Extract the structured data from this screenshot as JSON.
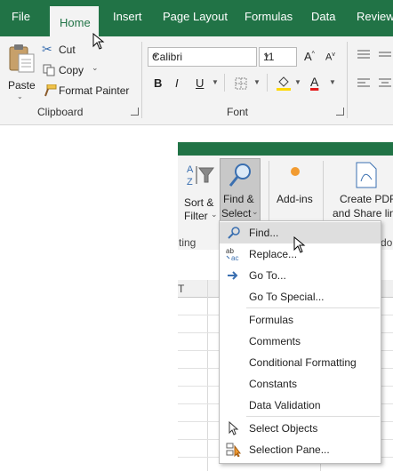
{
  "ribbon": {
    "tabs": [
      "File",
      "Home",
      "Insert",
      "Page Layout",
      "Formulas",
      "Data",
      "Review"
    ],
    "active_tab": "Home"
  },
  "clipboard": {
    "paste_label": "Paste",
    "cut_label": "Cut",
    "copy_label": "Copy",
    "format_painter_label": "Format Painter",
    "group_label": "Clipboard"
  },
  "font": {
    "font_name": "Calibri",
    "font_size": "11",
    "bold": "B",
    "italic": "I",
    "underline": "U",
    "group_label": "Font"
  },
  "editing": {
    "sort_filter_line1": "Sort &",
    "sort_filter_line2": "Filter",
    "find_select_line1": "Find &",
    "find_select_line2": "Select",
    "addins_label": "Add-ins",
    "create_pdf_line1": "Create PDF",
    "create_pdf_line2": "and Share lin",
    "group_fragment_left": "ting",
    "group_fragment_right": "do"
  },
  "menu": {
    "items": [
      {
        "label": "Find...",
        "icon": "magnifier-icon"
      },
      {
        "label": "Replace...",
        "icon": "replace-icon"
      },
      {
        "label": "Go To...",
        "icon": "arrow-right-icon"
      },
      {
        "label": "Go To Special..."
      },
      {
        "label": "Formulas"
      },
      {
        "label": "Comments"
      },
      {
        "label": "Conditional Formatting"
      },
      {
        "label": "Constants"
      },
      {
        "label": "Data Validation"
      },
      {
        "label": "Select Objects",
        "icon": "pointer-icon"
      },
      {
        "label": "Selection Pane...",
        "icon": "selection-pane-icon"
      }
    ]
  },
  "colors": {
    "excel_green": "#217346",
    "ribbon_bg": "#f3f3f3",
    "highlight": "#dedede",
    "font_color_red": "#e31c1c",
    "fill_yellow": "#ffd800"
  }
}
